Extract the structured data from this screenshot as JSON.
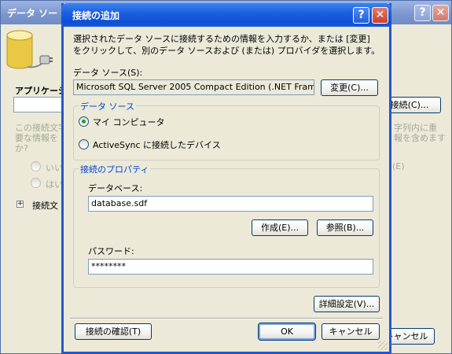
{
  "background_window": {
    "title": "データ ソー",
    "label_app": "アプリケーシ",
    "desc_left": "この接続文字\n要な情報を\nか?",
    "desc_right": "字列内に重\n報を含めます",
    "radio_1": "いい",
    "radio_2": "はい",
    "radio_e": "(E)",
    "expand_label": "接続文",
    "button_connection": "接続(C)...",
    "button_cancel": "キャンセル"
  },
  "dialog": {
    "title": "接続の追加",
    "help_glyph": "?",
    "close_glyph": "✕",
    "intro": "選択されたデータ ソースに接続するための情報を入力するか、または [変更] をクリックして、別のデータ ソースおよび (または) プロバイダを選択します。",
    "datasource_label": "データ ソース(S):",
    "datasource_value": "Microsoft SQL Server 2005 Compact Edition (.NET Framework",
    "change_button": "変更(C)...",
    "group_datasource": {
      "title": "データ ソース",
      "option_mycomputer": "マイ コンピュータ",
      "option_activesync": "ActiveSync に接続したデバイス"
    },
    "group_props": {
      "title": "接続のプロパティ",
      "database_label": "データベース:",
      "database_value": "database.sdf",
      "create_button": "作成(E)...",
      "browse_button": "参照(B)...",
      "password_label": "パスワード:",
      "password_value": "********"
    },
    "advanced_button": "詳細設定(V)...",
    "test_button": "接続の確認(T)",
    "ok_button": "OK",
    "cancel_button": "キャンセル"
  }
}
